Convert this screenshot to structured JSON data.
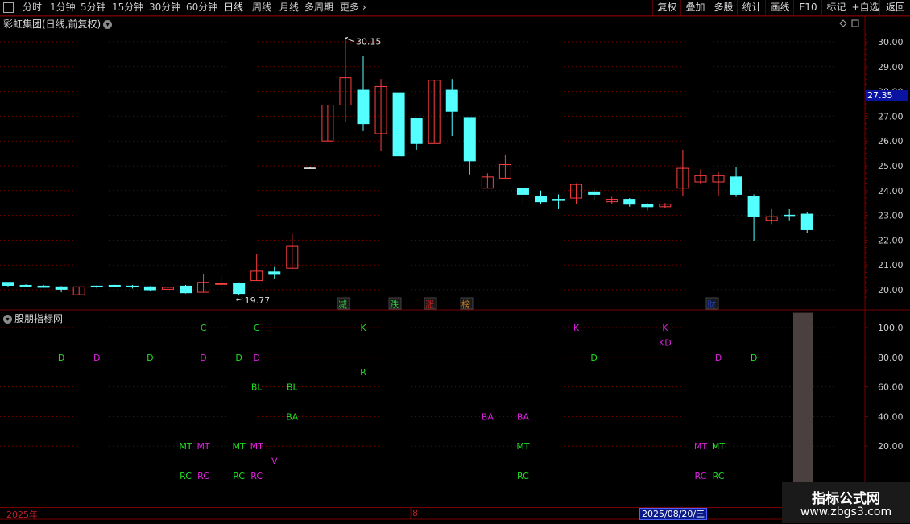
{
  "toolbar": {
    "periods": [
      "分时",
      "1分钟",
      "5分钟",
      "15分钟",
      "30分钟",
      "60分钟",
      "日线",
      "周线",
      "月线",
      "多周期",
      "更多"
    ],
    "more_arrow": "›",
    "active": "日线",
    "right_buttons": [
      "复权",
      "叠加",
      "多股",
      "统计",
      "画线",
      "F10",
      "标记",
      "+自选",
      "返回"
    ]
  },
  "chart": {
    "title": "彩虹集团(日线,前复权)",
    "price_axis": [
      "30.00",
      "29.00",
      "28.00",
      "27.00",
      "26.00",
      "25.00",
      "24.00",
      "23.00",
      "22.00",
      "21.00",
      "20.00"
    ],
    "current_price": "27.35",
    "high_label": "30.15",
    "low_label": "19.77",
    "event_tags": [
      {
        "text": "减",
        "color": "#2ecc40"
      },
      {
        "text": "跌",
        "color": "#2ecc40"
      },
      {
        "text": "涨",
        "color": "#d02020"
      },
      {
        "text": "榜",
        "color": "#c87820"
      },
      {
        "text": "财",
        "color": "#2040d0"
      }
    ]
  },
  "chart_data": {
    "type": "candlestick",
    "title": "彩虹集团(日线,前复权)",
    "ylim": [
      19.6,
      30.5
    ],
    "candles": [
      {
        "o": 20.18,
        "h": 20.3,
        "l": 20.1,
        "c": 20.3,
        "dir": "down"
      },
      {
        "o": 20.18,
        "h": 20.22,
        "l": 20.1,
        "c": 20.15,
        "dir": "down"
      },
      {
        "o": 20.15,
        "h": 20.2,
        "l": 20.08,
        "c": 20.1,
        "dir": "down"
      },
      {
        "o": 20.12,
        "h": 20.15,
        "l": 19.9,
        "c": 20.02,
        "dir": "down"
      },
      {
        "o": 19.8,
        "h": 20.12,
        "l": 19.8,
        "c": 20.12,
        "dir": "up"
      },
      {
        "o": 20.12,
        "h": 20.18,
        "l": 20.05,
        "c": 20.15,
        "dir": "down"
      },
      {
        "o": 20.18,
        "h": 20.2,
        "l": 20.1,
        "c": 20.12,
        "dir": "down"
      },
      {
        "o": 20.15,
        "h": 20.2,
        "l": 20.05,
        "c": 20.12,
        "dir": "down"
      },
      {
        "o": 20.12,
        "h": 20.15,
        "l": 19.95,
        "c": 20.0,
        "dir": "down"
      },
      {
        "o": 20.02,
        "h": 20.15,
        "l": 19.95,
        "c": 20.1,
        "dir": "up"
      },
      {
        "o": 20.15,
        "h": 20.2,
        "l": 19.85,
        "c": 19.88,
        "dir": "down"
      },
      {
        "o": 19.9,
        "h": 20.62,
        "l": 19.9,
        "c": 20.3,
        "dir": "up"
      },
      {
        "o": 20.22,
        "h": 20.55,
        "l": 20.1,
        "c": 20.25,
        "dir": "up"
      },
      {
        "o": 20.25,
        "h": 20.3,
        "l": 19.77,
        "c": 19.85,
        "dir": "down"
      },
      {
        "o": 20.37,
        "h": 21.45,
        "l": 20.37,
        "c": 20.75,
        "dir": "up"
      },
      {
        "o": 20.72,
        "h": 20.92,
        "l": 20.45,
        "c": 20.62,
        "dir": "down"
      },
      {
        "o": 20.87,
        "h": 22.25,
        "l": 20.87,
        "c": 21.75,
        "dir": "up"
      },
      {
        "o": 24.9,
        "h": 24.95,
        "l": 24.9,
        "c": 24.9,
        "dir": "flat"
      },
      {
        "o": 26.0,
        "h": 27.45,
        "l": 26.0,
        "c": 27.45,
        "dir": "up"
      },
      {
        "o": 27.45,
        "h": 30.15,
        "l": 26.75,
        "c": 28.55,
        "dir": "up"
      },
      {
        "o": 28.05,
        "h": 29.45,
        "l": 26.4,
        "c": 26.7,
        "dir": "down"
      },
      {
        "o": 26.3,
        "h": 28.5,
        "l": 25.6,
        "c": 28.2,
        "dir": "up"
      },
      {
        "o": 27.95,
        "h": 27.95,
        "l": 25.4,
        "c": 25.4,
        "dir": "down"
      },
      {
        "o": 26.9,
        "h": 26.9,
        "l": 25.65,
        "c": 25.9,
        "dir": "down"
      },
      {
        "o": 25.9,
        "h": 28.45,
        "l": 25.9,
        "c": 28.45,
        "dir": "up"
      },
      {
        "o": 28.05,
        "h": 28.5,
        "l": 26.2,
        "c": 27.2,
        "dir": "down"
      },
      {
        "o": 26.95,
        "h": 26.95,
        "l": 24.65,
        "c": 25.2,
        "dir": "down"
      },
      {
        "o": 24.1,
        "h": 24.7,
        "l": 24.1,
        "c": 24.55,
        "dir": "up"
      },
      {
        "o": 24.5,
        "h": 25.45,
        "l": 24.5,
        "c": 25.05,
        "dir": "up"
      },
      {
        "o": 24.1,
        "h": 24.15,
        "l": 23.45,
        "c": 23.85,
        "dir": "down"
      },
      {
        "o": 23.75,
        "h": 24.0,
        "l": 23.45,
        "c": 23.55,
        "dir": "down"
      },
      {
        "o": 23.65,
        "h": 23.85,
        "l": 23.25,
        "c": 23.6,
        "dir": "down"
      },
      {
        "o": 23.7,
        "h": 24.3,
        "l": 23.45,
        "c": 24.25,
        "dir": "up"
      },
      {
        "o": 23.95,
        "h": 24.05,
        "l": 23.65,
        "c": 23.85,
        "dir": "down"
      },
      {
        "o": 23.55,
        "h": 23.75,
        "l": 23.45,
        "c": 23.65,
        "dir": "up"
      },
      {
        "o": 23.65,
        "h": 23.7,
        "l": 23.35,
        "c": 23.45,
        "dir": "down"
      },
      {
        "o": 23.45,
        "h": 23.5,
        "l": 23.2,
        "c": 23.35,
        "dir": "down"
      },
      {
        "o": 23.35,
        "h": 23.5,
        "l": 23.3,
        "c": 23.45,
        "dir": "up"
      },
      {
        "o": 24.1,
        "h": 25.65,
        "l": 23.8,
        "c": 24.9,
        "dir": "up"
      },
      {
        "o": 24.35,
        "h": 24.85,
        "l": 24.25,
        "c": 24.6,
        "dir": "up"
      },
      {
        "o": 24.35,
        "h": 24.75,
        "l": 23.8,
        "c": 24.6,
        "dir": "up"
      },
      {
        "o": 24.55,
        "h": 24.95,
        "l": 23.75,
        "c": 23.85,
        "dir": "down"
      },
      {
        "o": 23.75,
        "h": 23.85,
        "l": 21.95,
        "c": 22.95,
        "dir": "down"
      },
      {
        "o": 22.8,
        "h": 23.25,
        "l": 22.65,
        "c": 22.95,
        "dir": "up"
      },
      {
        "o": 22.95,
        "h": 23.25,
        "l": 22.8,
        "c": 23.0,
        "dir": "flat-cross"
      },
      {
        "o": 23.05,
        "h": 23.15,
        "l": 22.3,
        "c": 22.42,
        "dir": "down"
      }
    ]
  },
  "indicator": {
    "title": "股朋指标网",
    "axis": [
      "100.0",
      "80.00",
      "60.00",
      "40.00",
      "20.00"
    ],
    "ylim": [
      0,
      115
    ],
    "signals": [
      {
        "t": "C",
        "v": 100,
        "c": "#22dd22",
        "i": 11
      },
      {
        "t": "C",
        "v": 100,
        "c": "#22dd22",
        "i": 14
      },
      {
        "t": "K",
        "v": 100,
        "c": "#22dd22",
        "i": 20
      },
      {
        "t": "K",
        "v": 100,
        "c": "#dd22dd",
        "i": 32
      },
      {
        "t": "K",
        "v": 100,
        "c": "#dd22dd",
        "i": 37
      },
      {
        "t": "KD",
        "v": 90,
        "c": "#dd22dd",
        "i": 37
      },
      {
        "t": "D",
        "v": 80,
        "c": "#22dd22",
        "i": 3
      },
      {
        "t": "D",
        "v": 80,
        "c": "#dd22dd",
        "i": 5
      },
      {
        "t": "D",
        "v": 80,
        "c": "#22dd22",
        "i": 8
      },
      {
        "t": "D",
        "v": 80,
        "c": "#dd22dd",
        "i": 11
      },
      {
        "t": "D",
        "v": 80,
        "c": "#22dd22",
        "i": 13
      },
      {
        "t": "D",
        "v": 80,
        "c": "#dd22dd",
        "i": 14
      },
      {
        "t": "D",
        "v": 80,
        "c": "#22dd22",
        "i": 33
      },
      {
        "t": "D",
        "v": 80,
        "c": "#dd22dd",
        "i": 40
      },
      {
        "t": "D",
        "v": 80,
        "c": "#22dd22",
        "i": 42
      },
      {
        "t": "R",
        "v": 70,
        "c": "#22dd22",
        "i": 20
      },
      {
        "t": "BL",
        "v": 60,
        "c": "#22dd22",
        "i": 14
      },
      {
        "t": "BL",
        "v": 60,
        "c": "#22dd22",
        "i": 16
      },
      {
        "t": "BA",
        "v": 40,
        "c": "#22dd22",
        "i": 16
      },
      {
        "t": "BA",
        "v": 40,
        "c": "#dd22dd",
        "i": 27
      },
      {
        "t": "BA",
        "v": 40,
        "c": "#dd22dd",
        "i": 29
      },
      {
        "t": "MT",
        "v": 20,
        "c": "#22dd22",
        "i": 10
      },
      {
        "t": "MT",
        "v": 20,
        "c": "#dd22dd",
        "i": 11
      },
      {
        "t": "MT",
        "v": 20,
        "c": "#22dd22",
        "i": 13
      },
      {
        "t": "MT",
        "v": 20,
        "c": "#dd22dd",
        "i": 14
      },
      {
        "t": "MT",
        "v": 20,
        "c": "#22dd22",
        "i": 29
      },
      {
        "t": "MT",
        "v": 20,
        "c": "#dd22dd",
        "i": 39
      },
      {
        "t": "MT",
        "v": 20,
        "c": "#22dd22",
        "i": 40
      },
      {
        "t": "V",
        "v": 10,
        "c": "#dd22dd",
        "i": 15
      },
      {
        "t": "RC",
        "v": 0,
        "c": "#22dd22",
        "i": 10
      },
      {
        "t": "RC",
        "v": 0,
        "c": "#dd22dd",
        "i": 11
      },
      {
        "t": "RC",
        "v": 0,
        "c": "#22dd22",
        "i": 13
      },
      {
        "t": "RC",
        "v": 0,
        "c": "#dd22dd",
        "i": 14
      },
      {
        "t": "RC",
        "v": 0,
        "c": "#22dd22",
        "i": 29
      },
      {
        "t": "RC",
        "v": 0,
        "c": "#dd22dd",
        "i": 39
      },
      {
        "t": "RC",
        "v": 0,
        "c": "#22dd22",
        "i": 40
      }
    ],
    "bar_value": 110
  },
  "timeline": {
    "year": "2025年",
    "month": "8",
    "cursor_date": "2025/08/20/三"
  },
  "watermark": {
    "title": "指标公式网",
    "url": "www.zbgs3.com"
  },
  "colors": {
    "up": "#ff4040",
    "down": "#54ffff",
    "grid": "#7a0000",
    "axis_text": "#d0d0d0"
  }
}
